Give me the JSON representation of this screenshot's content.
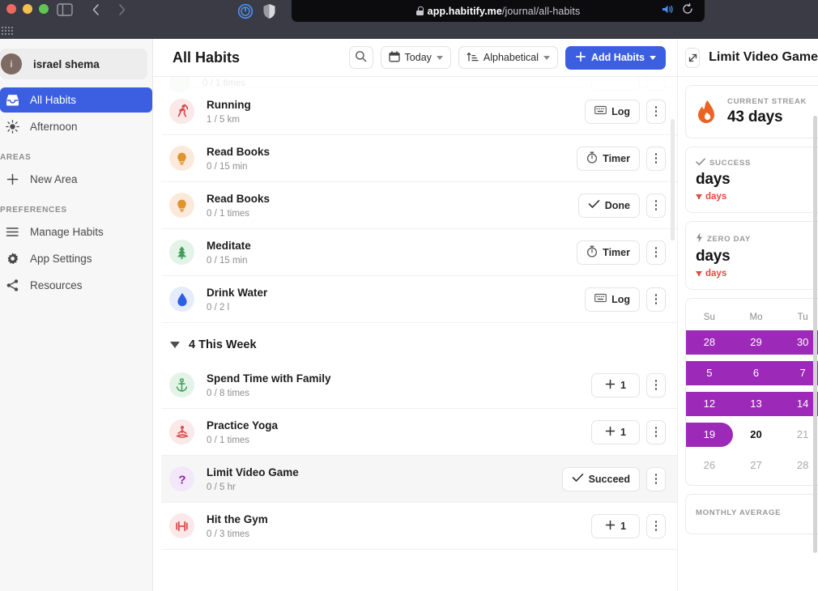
{
  "browser": {
    "url_host": "app.habitify.me",
    "url_path": "/journal/all-habits",
    "back_icon": "chevron-left-icon",
    "forward_icon": "chevron-right-icon",
    "sidebar_toggle_icon": "sidebar-toggle-icon",
    "extension_1_icon": "power-circle-icon",
    "extension_2_icon": "shield-icon",
    "mute_icon": "speaker-icon",
    "reload_icon": "reload-icon",
    "lock_icon": "lock-icon",
    "grid_icon": "grid-dots-icon"
  },
  "sidebar": {
    "user": {
      "name": "israel shema",
      "avatar_initial": "i"
    },
    "nav": [
      {
        "label": "All Habits",
        "icon": "inbox-icon",
        "active": true
      },
      {
        "label": "Afternoon",
        "icon": "sun-icon",
        "active": false
      }
    ],
    "areas_section": "AREAS",
    "areas": [
      {
        "label": "New Area",
        "icon": "plus-icon"
      }
    ],
    "preferences_section": "PREFERENCES",
    "preferences": [
      {
        "label": "Manage Habits",
        "icon": "list-icon"
      },
      {
        "label": "App Settings",
        "icon": "gear-icon"
      },
      {
        "label": "Resources",
        "icon": "share-icon"
      }
    ]
  },
  "header": {
    "title": "All Habits",
    "search_icon": "search-icon",
    "date_filter": {
      "label": "Today",
      "icon": "calendar-icon"
    },
    "sort_filter": {
      "label": "Alphabetical",
      "icon": "sort-icon"
    },
    "add_button": {
      "label": "Add Habits",
      "icon": "plus-icon"
    }
  },
  "habits": {
    "partial_top_row": {
      "name": "",
      "progress": "0 / 1 times"
    },
    "morning_rows": [
      {
        "name": "Running",
        "progress": "1 / 5 km",
        "action": "Log",
        "action_icon": "keyboard-icon",
        "icon": "runner-icon",
        "icon_color": "#d94c4c",
        "icon_bg": "#fbe8e8"
      },
      {
        "name": "Read Books",
        "progress": "0 / 15 min",
        "action": "Timer",
        "action_icon": "stopwatch-icon",
        "icon": "bulb-icon",
        "icon_color": "#e0942e",
        "icon_bg": "#fbeadc"
      },
      {
        "name": "Read Books",
        "progress": "0 / 1 times",
        "action": "Done",
        "action_icon": "check-icon",
        "icon": "bulb-icon",
        "icon_color": "#e0942e",
        "icon_bg": "#fbeadc"
      },
      {
        "name": "Meditate",
        "progress": "0 / 15 min",
        "action": "Timer",
        "action_icon": "stopwatch-icon",
        "icon": "tree-icon",
        "icon_color": "#3f9e57",
        "icon_bg": "#e4f3e7"
      },
      {
        "name": "Drink Water",
        "progress": "0 / 2 l",
        "action": "Log",
        "action_icon": "keyboard-icon",
        "icon": "water-drop-icon",
        "icon_color": "#2d5fe3",
        "icon_bg": "#e6ecfb"
      }
    ],
    "week_group": {
      "label": "4 This Week",
      "collapse_icon": "triangle-down-icon"
    },
    "week_rows": [
      {
        "name": "Spend Time with Family",
        "progress": "0 / 8 times",
        "action": "1",
        "action_icon": "plus-icon",
        "icon": "anchor-icon",
        "icon_color": "#3f9e57",
        "icon_bg": "#e4f3e7",
        "selected": false
      },
      {
        "name": "Practice Yoga",
        "progress": "0 / 1 times",
        "action": "1",
        "action_icon": "plus-icon",
        "icon": "yoga-icon",
        "icon_color": "#d94c4c",
        "icon_bg": "#fbe8e8",
        "selected": false
      },
      {
        "name": "Limit Video Game",
        "progress": "0 / 5 hr",
        "action": "Succeed",
        "action_icon": "check-icon",
        "icon": "question-icon",
        "icon_color": "#8e24aa",
        "icon_bg": "#f3e8fa",
        "selected": true
      },
      {
        "name": "Hit the Gym",
        "progress": "0 / 3 times",
        "action": "1",
        "action_icon": "plus-icon",
        "icon": "dumbbell-icon",
        "icon_color": "#d94c4c",
        "icon_bg": "#fbe8e8",
        "selected": false
      }
    ]
  },
  "detail_panel": {
    "title": "Limit Video Game",
    "expand_icon": "expand-diagonal-icon",
    "streak": {
      "label": "CURRENT STREAK",
      "value": "43 days",
      "icon": "flame-icon"
    },
    "success": {
      "label": "SUCCESS",
      "icon": "check-icon",
      "value": "days",
      "delta": "days",
      "delta_icon": "arrow-down-icon"
    },
    "zero_day": {
      "label": "ZERO DAY",
      "icon": "bolt-icon",
      "value": "days",
      "delta": "days",
      "delta_icon": "arrow-down-icon"
    },
    "calendar": {
      "weekday_headers": [
        "Su",
        "Mo",
        "Tu"
      ],
      "rows": [
        {
          "days": [
            "28",
            "29",
            "30"
          ],
          "highlighted": true,
          "cap_end": false,
          "today_index": -1,
          "dim": false
        },
        {
          "days": [
            "5",
            "6",
            "7"
          ],
          "highlighted": true,
          "cap_end": false,
          "today_index": -1,
          "dim": false
        },
        {
          "days": [
            "12",
            "13",
            "14"
          ],
          "highlighted": true,
          "cap_end": false,
          "today_index": -1,
          "dim": false
        },
        {
          "days": [
            "19",
            "20",
            "21"
          ],
          "highlighted": false,
          "cap_end": true,
          "today_index": 1,
          "dim": false
        },
        {
          "days": [
            "26",
            "27",
            "28"
          ],
          "highlighted": false,
          "cap_end": false,
          "today_index": -1,
          "dim": true
        }
      ],
      "highlight_color": "#9c29b8"
    },
    "monthly_average": {
      "label": "MONTHLY AVERAGE"
    }
  },
  "theme": {
    "accent_blue": "#3b5fe0",
    "purple": "#9c29b8",
    "red": "#e04a3f",
    "chrome_bg": "#3a3b44"
  }
}
